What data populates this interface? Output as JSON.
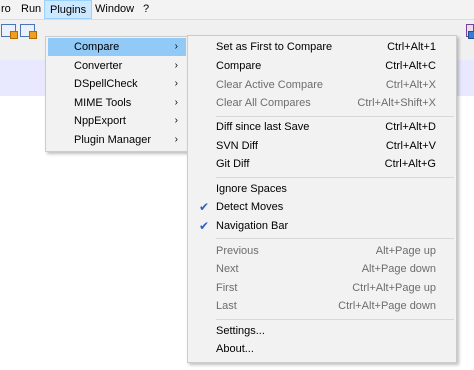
{
  "menubar": {
    "items": [
      "ro",
      "Run",
      "Plugins",
      "Window",
      "?"
    ]
  },
  "plugins_menu": {
    "items": [
      {
        "label": "Compare",
        "submenu": true
      },
      {
        "label": "Converter",
        "submenu": true
      },
      {
        "label": "DSpellCheck",
        "submenu": true
      },
      {
        "label": "MIME Tools",
        "submenu": true
      },
      {
        "label": "NppExport",
        "submenu": true
      },
      {
        "label": "Plugin Manager",
        "submenu": true
      }
    ],
    "arrow": "›"
  },
  "compare_menu": {
    "items": [
      {
        "label": "Set as First to Compare",
        "shortcut": "Ctrl+Alt+1"
      },
      {
        "label": "Compare",
        "shortcut": "Ctrl+Alt+C"
      },
      {
        "label": "Clear Active Compare",
        "shortcut": "Ctrl+Alt+X"
      },
      {
        "label": "Clear All Compares",
        "shortcut": "Ctrl+Alt+Shift+X"
      },
      {
        "label": "Diff since last Save",
        "shortcut": "Ctrl+Alt+D"
      },
      {
        "label": "SVN Diff",
        "shortcut": "Ctrl+Alt+V"
      },
      {
        "label": "Git Diff",
        "shortcut": "Ctrl+Alt+G"
      },
      {
        "label": "Ignore Spaces",
        "shortcut": ""
      },
      {
        "label": "Detect Moves",
        "shortcut": ""
      },
      {
        "label": "Navigation Bar",
        "shortcut": ""
      },
      {
        "label": "Previous",
        "shortcut": "Alt+Page up"
      },
      {
        "label": "Next",
        "shortcut": "Alt+Page down"
      },
      {
        "label": "First",
        "shortcut": "Ctrl+Alt+Page up"
      },
      {
        "label": "Last",
        "shortcut": "Ctrl+Alt+Page down"
      },
      {
        "label": "Settings...",
        "shortcut": ""
      },
      {
        "label": "About...",
        "shortcut": ""
      }
    ],
    "check_glyph": "✔"
  },
  "colors": {
    "hover": "#91c9f7",
    "checkmark": "#2d5fc4",
    "disabled_text": "#6d6d6d"
  }
}
